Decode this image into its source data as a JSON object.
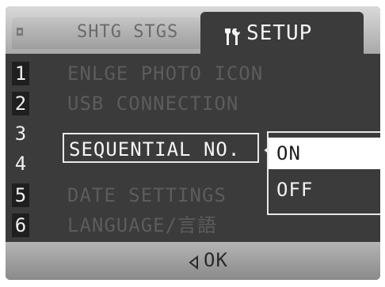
{
  "tabs": {
    "shooting": {
      "label": "SHTG STGS",
      "icon": "camera-icon"
    },
    "setup": {
      "label": "SETUP",
      "icon": "wrench-screwdriver-icon"
    }
  },
  "menu": {
    "items": [
      {
        "num": "1",
        "label": "ENLGE PHOTO ICON"
      },
      {
        "num": "2",
        "label": "USB CONNECTION"
      },
      {
        "num": "3",
        "label": "SEQUENTIAL NO."
      },
      {
        "num": "4",
        "label": ""
      },
      {
        "num": "5",
        "label": "DATE SETTINGS"
      },
      {
        "num": "6",
        "label": "LANGUAGE/言語"
      }
    ],
    "selected_index": 2
  },
  "popup": {
    "options": [
      "ON",
      "OFF"
    ],
    "selected": "ON"
  },
  "footer": {
    "label": "OK",
    "icon": "left-arrow-icon"
  },
  "colors": {
    "screen_bg": "#3b3b3b",
    "highlight": "#ffffff",
    "dim_text": "#5c5c5c"
  }
}
